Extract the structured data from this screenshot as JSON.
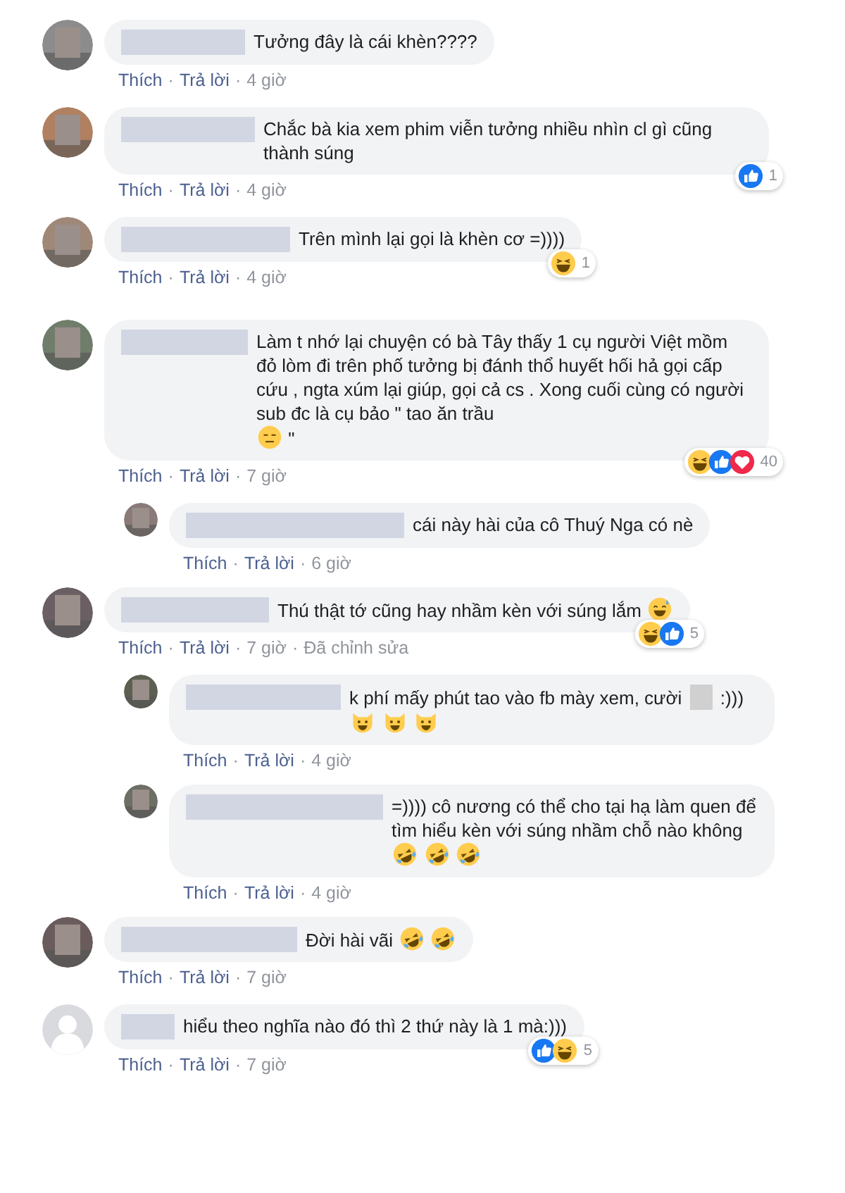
{
  "separator": "·",
  "comments": [
    {
      "avatar": {
        "kind": "photo"
      },
      "parts": [
        {
          "kind": "redacted"
        },
        {
          "kind": "text",
          "text": "Tưởng đây là cái khèn????"
        }
      ],
      "actions": {
        "like": "Thích",
        "reply": "Trả lời",
        "time": "4 giờ"
      }
    },
    {
      "avatar": {
        "kind": "photo"
      },
      "parts": [
        {
          "kind": "redacted"
        },
        {
          "kind": "text",
          "text": "Chắc bà kia xem phim viễn tưởng nhiều nhìn cl gì cũng thành súng"
        }
      ],
      "actions": {
        "like": "Thích",
        "reply": "Trả lời",
        "time": "4 giờ"
      },
      "reactions": {
        "icons": [
          {
            "kind": "like"
          }
        ],
        "count": "1"
      }
    },
    {
      "avatar": {
        "kind": "photo"
      },
      "parts": [
        {
          "kind": "redacted"
        },
        {
          "kind": "text",
          "text": "Trên mình lại gọi là khèn cơ =))))"
        }
      ],
      "actions": {
        "like": "Thích",
        "reply": "Trả lời",
        "time": "4 giờ"
      },
      "reactions": {
        "icons": [
          {
            "kind": "haha"
          }
        ],
        "count": "1"
      }
    },
    {
      "avatar": {
        "kind": "photo"
      },
      "parts": [
        {
          "kind": "redacted"
        },
        {
          "kind": "text",
          "text": "Làm t nhớ lại chuyện có bà Tây thấy 1 cụ người Việt mồm đỏ lòm đi trên phố tưởng bị đánh thổ huyết hối hả gọi cấp cứu , ngta xúm lại giúp, gọi cả cs . Xong cuối cùng có người sub đc là cụ bảo \" tao ăn trầu"
        },
        {
          "kind": "emoji-expressionless"
        },
        {
          "kind": "text",
          "text": "\""
        }
      ],
      "actions": {
        "like": "Thích",
        "reply": "Trả lời",
        "time": "7 giờ"
      },
      "reactions": {
        "icons": [
          {
            "kind": "haha"
          },
          {
            "kind": "like"
          },
          {
            "kind": "love"
          }
        ],
        "count": "40"
      },
      "replies": [
        {
          "avatar": {
            "kind": "photo"
          },
          "parts": [
            {
              "kind": "redacted"
            },
            {
              "kind": "text",
              "text": "cái này hài của cô Thuý Nga có nè"
            }
          ],
          "actions": {
            "like": "Thích",
            "reply": "Trả lời",
            "time": "6 giờ"
          }
        }
      ]
    },
    {
      "avatar": {
        "kind": "photo"
      },
      "parts": [
        {
          "kind": "redacted"
        },
        {
          "kind": "text",
          "text": "Thú thật tớ cũng hay nhầm kèn với súng lắm"
        },
        {
          "kind": "emoji-sweat-smile"
        }
      ],
      "actions": {
        "like": "Thích",
        "reply": "Trả lời",
        "time": "7 giờ",
        "edited": "Đã chỉnh sửa"
      },
      "reactions": {
        "icons": [
          {
            "kind": "haha"
          },
          {
            "kind": "like"
          }
        ],
        "count": "5"
      },
      "replies": [
        {
          "avatar": {
            "kind": "photo"
          },
          "parts": [
            {
              "kind": "redacted"
            },
            {
              "kind": "text",
              "text": "k phí mấy phút tao vào fb mày xem, cười"
            },
            {
              "kind": "redacted"
            },
            {
              "kind": "text",
              "text": ":)))"
            },
            {
              "kind": "emoji-cat"
            },
            {
              "kind": "emoji-cat"
            },
            {
              "kind": "emoji-cat"
            }
          ],
          "actions": {
            "like": "Thích",
            "reply": "Trả lời",
            "time": "4 giờ"
          }
        },
        {
          "avatar": {
            "kind": "photo"
          },
          "parts": [
            {
              "kind": "redacted"
            },
            {
              "kind": "text",
              "text": "=)))) cô nương có thể cho tại hạ làm quen để tìm hiểu kèn với súng nhầm chỗ nào không"
            },
            {
              "kind": "emoji-rofl"
            },
            {
              "kind": "emoji-rofl"
            },
            {
              "kind": "emoji-rofl"
            }
          ],
          "actions": {
            "like": "Thích",
            "reply": "Trả lời",
            "time": "4 giờ"
          }
        }
      ]
    },
    {
      "avatar": {
        "kind": "photo"
      },
      "parts": [
        {
          "kind": "redacted"
        },
        {
          "kind": "text",
          "text": "Đời hài vãi"
        },
        {
          "kind": "emoji-rofl"
        },
        {
          "kind": "emoji-rofl"
        }
      ],
      "actions": {
        "like": "Thích",
        "reply": "Trả lời",
        "time": "7 giờ"
      }
    },
    {
      "avatar": {
        "kind": "default"
      },
      "parts": [
        {
          "kind": "redacted"
        },
        {
          "kind": "text",
          "text": "hiểu theo nghĩa nào đó thì 2 thứ này là 1 mà:)))"
        }
      ],
      "actions": {
        "like": "Thích",
        "reply": "Trả lời",
        "time": "7 giờ"
      },
      "reactions": {
        "icons": [
          {
            "kind": "like"
          },
          {
            "kind": "haha"
          }
        ],
        "count": "5"
      }
    }
  ]
}
